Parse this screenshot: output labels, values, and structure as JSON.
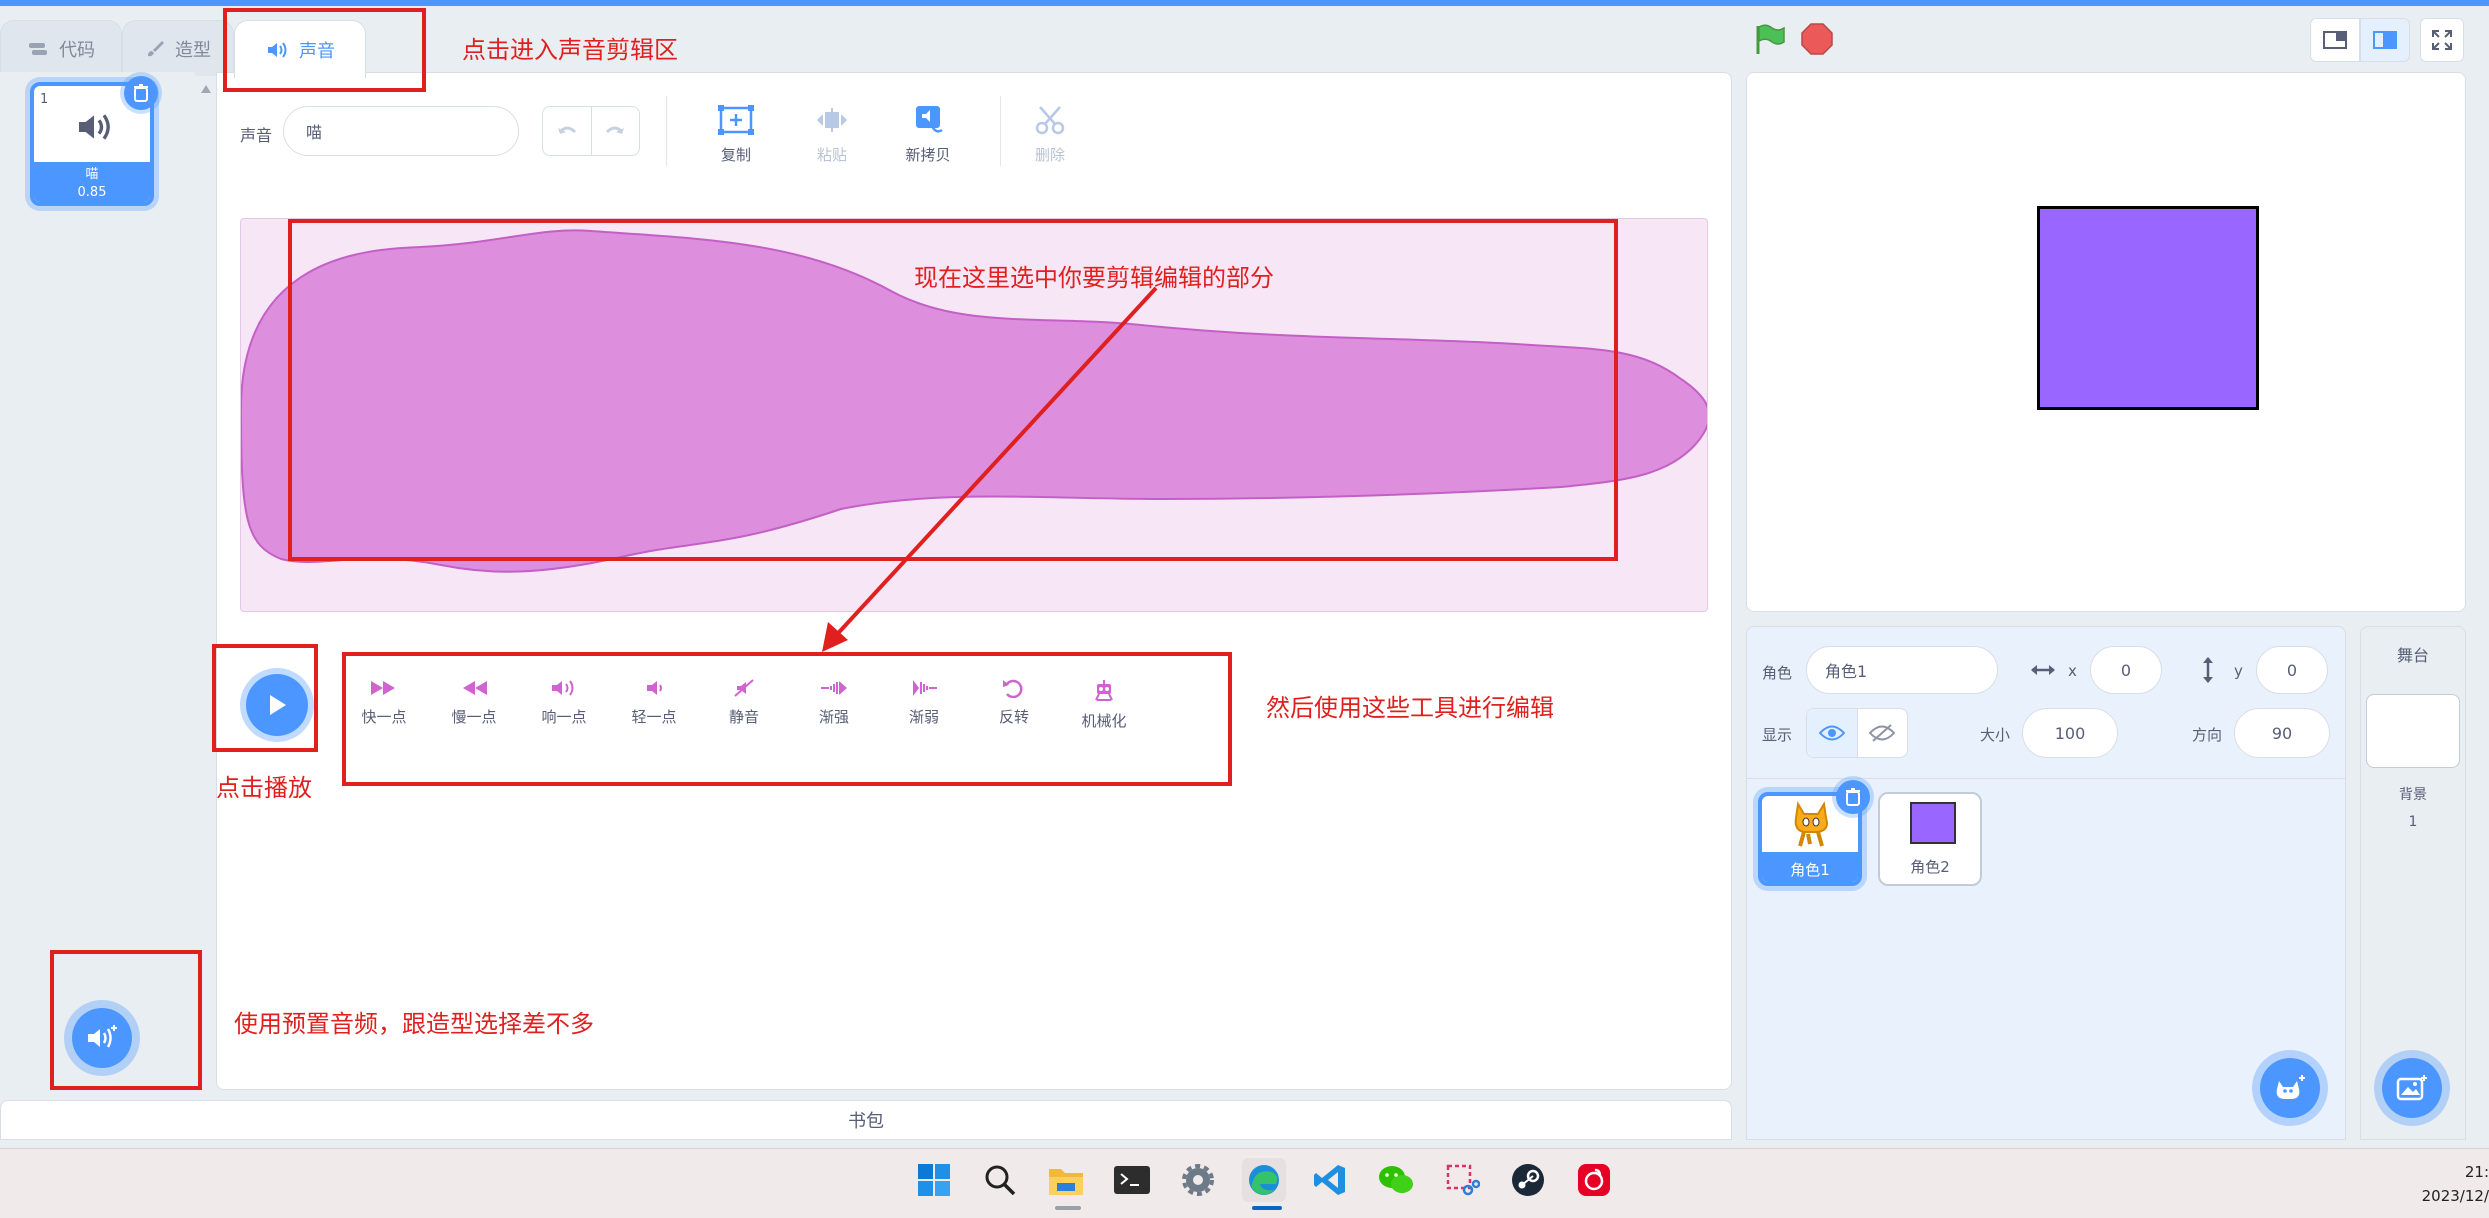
{
  "tabs": [
    {
      "label": "代码",
      "icon": "code-icon"
    },
    {
      "label": "造型",
      "icon": "brush-icon"
    },
    {
      "label": "声音",
      "icon": "speaker-icon"
    }
  ],
  "sound_list": [
    {
      "index": "1",
      "name": "喵",
      "duration": "0.85",
      "icon": "speaker-icon"
    }
  ],
  "editor": {
    "sound_label": "声音",
    "sound_name": "喵",
    "tools": {
      "copy": "复制",
      "paste": "粘贴",
      "copy_new": "新拷贝",
      "delete": "删除"
    }
  },
  "effects": [
    "快一点",
    "慢一点",
    "响一点",
    "轻一点",
    "静音",
    "渐强",
    "渐弱",
    "反转",
    "机械化"
  ],
  "annotations": {
    "tab": "点击进入声音剪辑区",
    "select": "现在这里选中你要剪辑编辑的部分",
    "tools": "然后使用这些工具进行编辑",
    "play": "点击播放",
    "preset": "使用预置音频，跟造型选择差不多"
  },
  "backpack_label": "书包",
  "sprite_info": {
    "sprite_label": "角色",
    "sprite_name": "角色1",
    "x_label": "x",
    "x": "0",
    "y_label": "y",
    "y": "0",
    "show_label": "显示",
    "size_label": "大小",
    "size": "100",
    "direction_label": "方向",
    "direction": "90"
  },
  "sprites": [
    {
      "name": "角色1",
      "selected": true
    },
    {
      "name": "角色2",
      "selected": false
    }
  ],
  "stage_panel": {
    "title": "舞台",
    "backdrop_label": "背景",
    "backdrop_count": "1"
  },
  "clock": {
    "time": "21:",
    "date": "2023/12/"
  },
  "colors": {
    "accent": "#4c97ff",
    "annotation": "#e0201f",
    "waveform": "#cf63cf",
    "sprite2": "#9966ff"
  },
  "taskbar_apps": [
    "windows-start-icon",
    "search-icon",
    "file-explorer-icon",
    "terminal-icon",
    "settings-icon",
    "edge-browser-icon",
    "vscode-icon",
    "wechat-icon",
    "snipping-tool-icon",
    "steam-icon",
    "netease-music-icon"
  ]
}
